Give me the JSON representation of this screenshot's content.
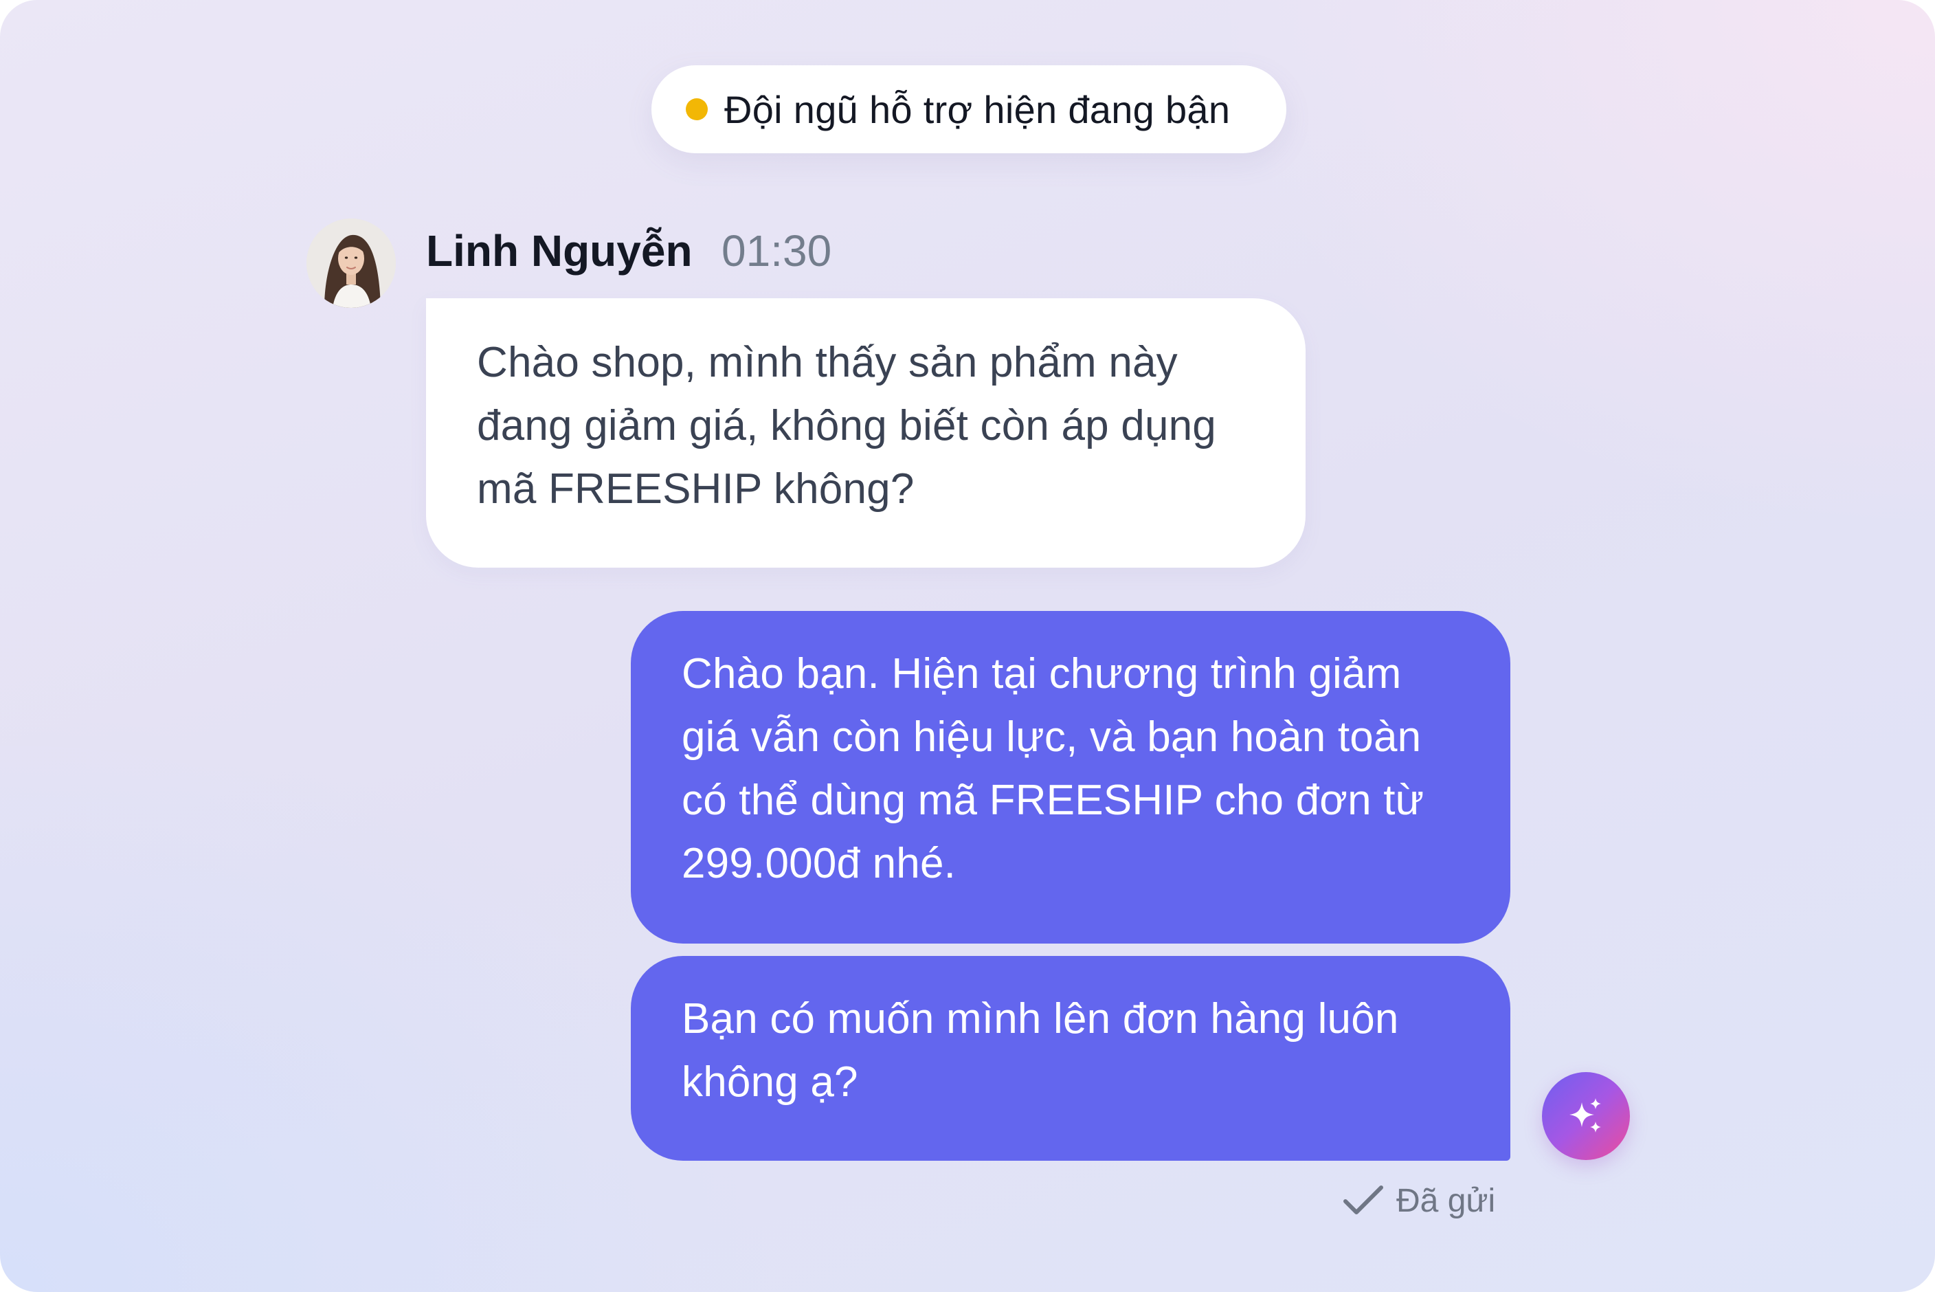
{
  "status": {
    "text": "Đội ngũ hỗ trợ hiện đang bận",
    "dot_color": "#f2b705"
  },
  "incoming": {
    "sender_name": "Linh Nguyễn",
    "time": "01:30",
    "avatar": "avatar-photo",
    "message": "Chào shop, mình thấy sản phẩm này đang giảm giá, không biết còn áp dụng mã FREESHIP không?"
  },
  "outgoing": {
    "messages": [
      "Chào bạn. Hiện tại chương trình giảm giá vẫn còn hiệu lực, và bạn hoàn toàn có thể dùng mã FREESHIP cho đơn từ 299.000đ nhé.",
      "Bạn có muốn mình lên đơn hàng luôn không ạ?"
    ],
    "bubble_color": "#6366ee",
    "ai_icon": "sparkles-icon",
    "status_icon": "check-icon",
    "status_text": "Đã gửi"
  }
}
